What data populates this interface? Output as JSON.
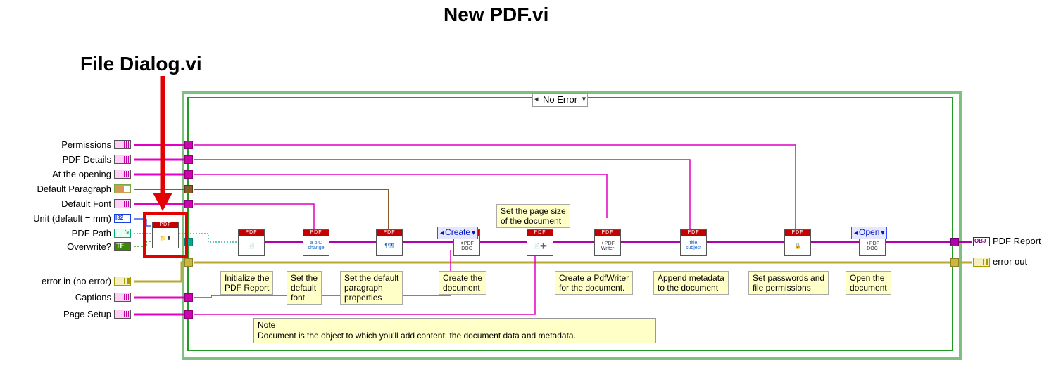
{
  "page_title": "New PDF.vi",
  "annotation_title": "File Dialog.vi",
  "case_selector": "No Error",
  "inputs": {
    "permissions": "Permissions",
    "pdf_details": "PDF Details",
    "at_opening": "At the opening",
    "default_paragraph": "Default Paragraph",
    "default_font": "Default Font",
    "unit": "Unit (default = mm)",
    "pdf_path": "PDF Path",
    "overwrite": "Overwrite?",
    "error_in": "error in (no error)",
    "captions": "Captions",
    "page_setup": "Page Setup"
  },
  "outputs": {
    "pdf_report": "PDF Report",
    "error_out": "error out"
  },
  "pills": {
    "create": "Create",
    "open": "Open"
  },
  "page_size_tip": "Set the page size\nof the document",
  "steps": {
    "s1": "Initialize the\nPDF Report",
    "s2": "Set the\ndefault\nfont",
    "s3": "Set the default\nparagraph\nproperties",
    "s4": "Create the\ndocument",
    "s5": "Create a PdfWriter\nfor the document.",
    "s6": "Append metadata\nto the document",
    "s7": "Set passwords and\nfile permissions",
    "s8": "Open the\ndocument"
  },
  "note_title": "Note",
  "note_body": "Document is the object to which you'll add content: the document data and metadata.",
  "vi_header": "PDF",
  "vi_bodies": {
    "dialog": "📁⬇",
    "init": "📄",
    "font": "a b C\nchange",
    "para": "¶¶¶",
    "doc": "✦PDF\nDOC",
    "plus": "📄➕",
    "writer": "✦PDF\nWriter",
    "meta": "title\nsubject",
    "lock": "🔒",
    "open": "✦PDF\nDOC"
  }
}
